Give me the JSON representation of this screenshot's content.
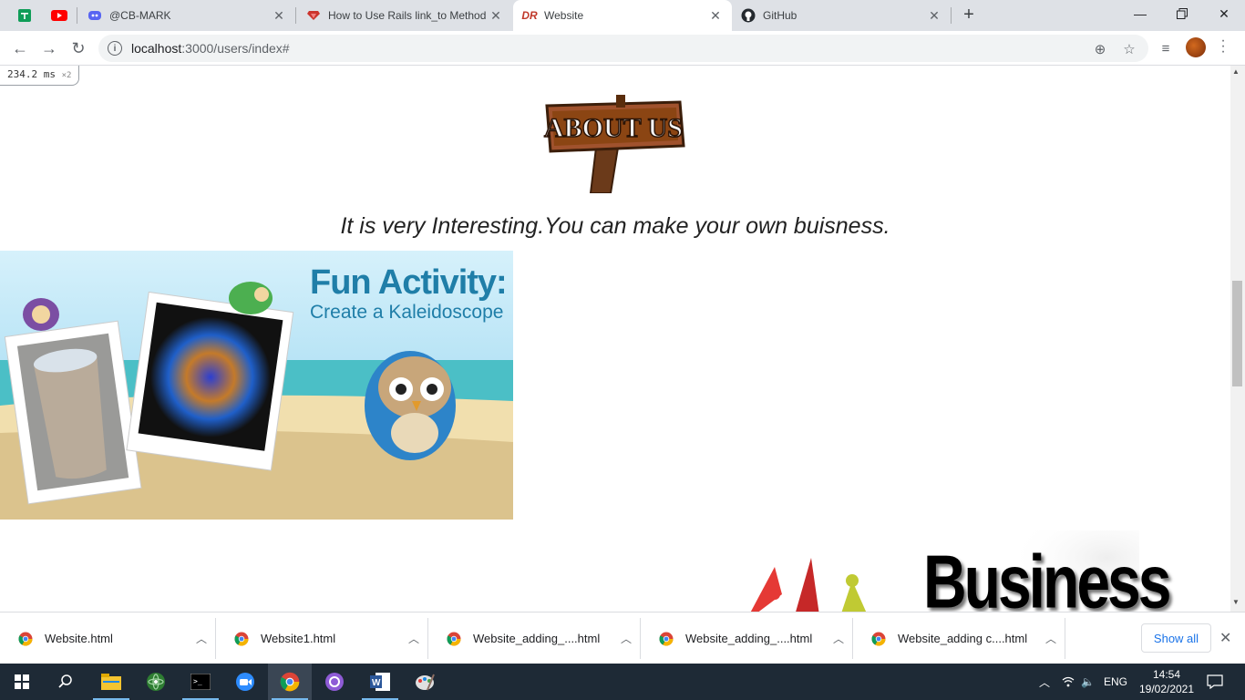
{
  "browser": {
    "tabs": [
      {
        "title": "@CB-MARK",
        "icon": "discord-icon"
      },
      {
        "title": "How to Use Rails link_to Method",
        "icon": "ruby-icon"
      },
      {
        "title": "Website",
        "icon": "dr-logo-icon",
        "active": true
      },
      {
        "title": "GitHub",
        "icon": "github-icon"
      }
    ],
    "pinned": [
      "google-sheets-icon",
      "youtube-icon"
    ],
    "new_tab": "+",
    "url_host": "localhost",
    "url_path": ":3000/users/index#"
  },
  "page": {
    "perf_ms": "234.2",
    "perf_unit": "ms",
    "perf_count": "×2",
    "sign_text": "ABOUT US",
    "tagline": "It is very Interesting.You can make your own buisness.",
    "banner_title": "Fun Activity:",
    "banner_subtitle": "Create a Kaleidoscope",
    "business_text": "Business"
  },
  "downloads": {
    "items": [
      {
        "name": "Website.html"
      },
      {
        "name": "Website1.html"
      },
      {
        "name": "Website_adding_....html"
      },
      {
        "name": "Website_adding_....html"
      },
      {
        "name": "Website_adding c....html"
      }
    ],
    "show_all": "Show all"
  },
  "taskbar": {
    "apps": [
      "start-icon",
      "search-icon",
      "file-explorer-icon",
      "atom-icon",
      "terminal-icon",
      "zoom-icon",
      "chrome-icon",
      "github-desktop-icon",
      "word-icon",
      "paint-icon"
    ],
    "lang": "ENG",
    "time": "14:54",
    "date": "19/02/2021"
  },
  "colors": {
    "accent": "#1a73e8",
    "taskbar": "#1e2a36",
    "banner_text": "#1f7ea8"
  }
}
